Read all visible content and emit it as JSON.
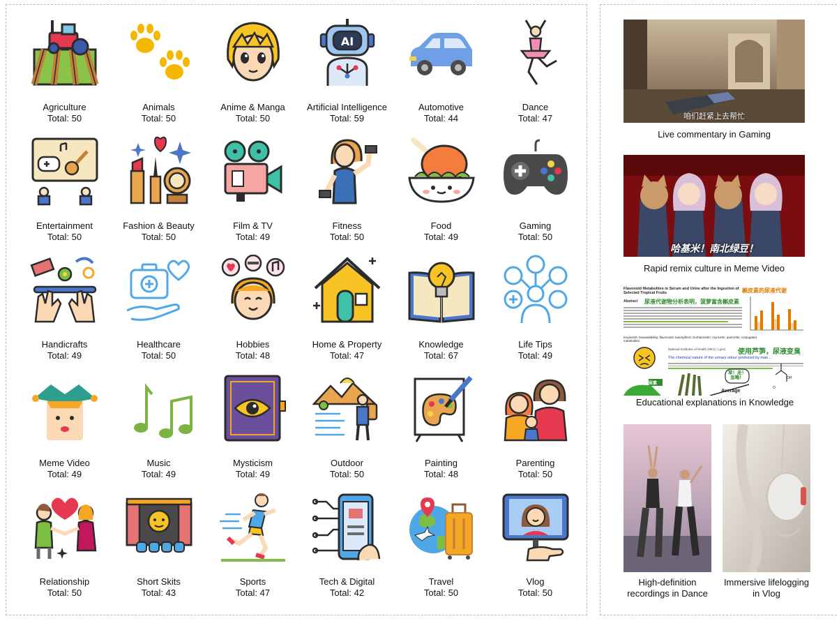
{
  "categories": [
    {
      "name": "Agriculture",
      "total": "Total: 50",
      "icon": "tractor-field-icon"
    },
    {
      "name": "Animals",
      "total": "Total: 50",
      "icon": "paw-prints-icon"
    },
    {
      "name": "Anime & Manga",
      "total": "Total: 50",
      "icon": "anime-face-icon"
    },
    {
      "name": "Artificial Intelligence",
      "total": "Total: 59",
      "icon": "ai-robot-icon"
    },
    {
      "name": "Automotive",
      "total": "Total: 44",
      "icon": "car-icon"
    },
    {
      "name": "Dance",
      "total": "Total: 47",
      "icon": "ballerina-icon"
    },
    {
      "name": "Entertainment",
      "total": "Total: 50",
      "icon": "screen-guitar-controller-icon"
    },
    {
      "name": "Fashion & Beauty",
      "total": "Total: 50",
      "icon": "lipstick-mirror-icon"
    },
    {
      "name": "Film & TV",
      "total": "Total: 49",
      "icon": "film-camera-icon"
    },
    {
      "name": "Fitness",
      "total": "Total: 50",
      "icon": "dumbbell-woman-icon"
    },
    {
      "name": "Food",
      "total": "Total: 49",
      "icon": "roast-chicken-icon"
    },
    {
      "name": "Gaming",
      "total": "Total: 50",
      "icon": "gamepad-icon"
    },
    {
      "name": "Handicrafts",
      "total": "Total: 49",
      "icon": "crafting-hands-icon"
    },
    {
      "name": "Healthcare",
      "total": "Total: 50",
      "icon": "medkit-hand-heart-icon"
    },
    {
      "name": "Hobbies",
      "total": "Total: 48",
      "icon": "hobbies-girl-icon"
    },
    {
      "name": "Home & Property",
      "total": "Total: 47",
      "icon": "house-icon"
    },
    {
      "name": "Knowledge",
      "total": "Total: 67",
      "icon": "book-lightbulb-icon"
    },
    {
      "name": "Life Tips",
      "total": "Total: 49",
      "icon": "life-tips-person-icon"
    },
    {
      "name": "Meme Video",
      "total": "Total: 49",
      "icon": "jester-face-icon"
    },
    {
      "name": "Music",
      "total": "Total: 49",
      "icon": "music-notes-icon"
    },
    {
      "name": "Mysticism",
      "total": "Total: 49",
      "icon": "mystic-book-eye-icon"
    },
    {
      "name": "Outdoor",
      "total": "Total: 50",
      "icon": "hiker-mountains-icon"
    },
    {
      "name": "Painting",
      "total": "Total: 48",
      "icon": "palette-brush-icon"
    },
    {
      "name": "Parenting",
      "total": "Total: 50",
      "icon": "family-icon"
    },
    {
      "name": "Relationship",
      "total": "Total: 50",
      "icon": "couple-heart-icon"
    },
    {
      "name": "Short Skits",
      "total": "Total: 43",
      "icon": "theater-stage-icon"
    },
    {
      "name": "Sports",
      "total": "Total: 47",
      "icon": "runner-icon"
    },
    {
      "name": "Tech & Digital",
      "total": "Total: 42",
      "icon": "smartphone-circuit-icon"
    },
    {
      "name": "Travel",
      "total": "Total: 50",
      "icon": "globe-suitcase-icon"
    },
    {
      "name": "Vlog",
      "total": "Total: 50",
      "icon": "selfie-stick-icon"
    }
  ],
  "examples": {
    "gaming": {
      "caption": "Live commentary in Gaming",
      "subtitle": "咱们赶紧上去帮忙"
    },
    "meme": {
      "caption": "Rapid remix culture in Meme Video",
      "subtitle": "哈基米！南北绿豆！"
    },
    "knowledge": {
      "caption": "Educational explanations in Knowledge",
      "paper_title": "Flavonoid Metabolites in Serum and Urine after the Ingestion of Selected Tropical Fruits",
      "abstract_label": "Abstract",
      "overlay_top_right": "槲皮素的尿液代谢",
      "overlay_mid": "尿液代谢物分析表明，菠萝富含槲皮素",
      "keywords": "Keywords: bioavailability; flavonoids; kaempferol; isorhamnetin; myricetin; quercetin; conjugated metabolites",
      "nih_label": "National Institutes of Health (NIH) | (.gov)",
      "nih_overlay": "使用芦笋，尿液变臭",
      "nih_title": "The chemical nature of the urinary odour produced by man ...",
      "cartoon_tag": "尿素",
      "speech": "草！走！\n忽略！",
      "average_label": "Average",
      "oh_label": "OH",
      "o_label": "O"
    },
    "dance": {
      "caption": "High-definition recordings in Dance"
    },
    "vlog": {
      "caption": "Immersive lifelogging in Vlog"
    }
  },
  "colors": {
    "border": "#b9b9b9",
    "outline": "#2b2b2b",
    "meme_bg": "#7a0d10",
    "knowledge_green": "#2e8b2e",
    "knowledge_orange": "#e07b00"
  }
}
